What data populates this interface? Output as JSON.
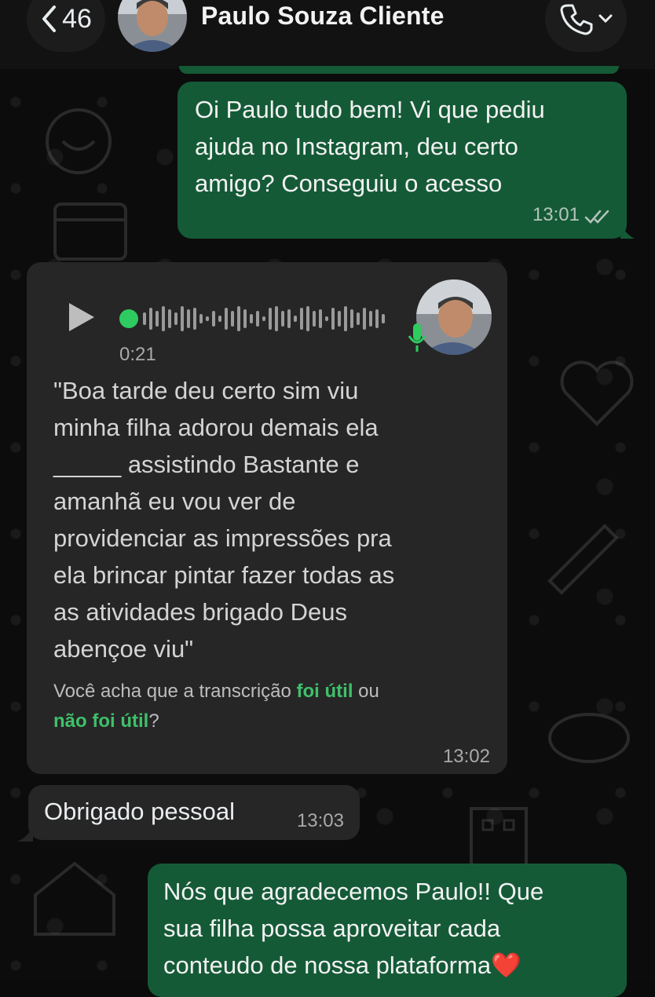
{
  "header": {
    "back_count": "46",
    "contact_name": "Paulo Souza Cliente",
    "back_icon": "chevron-left-icon",
    "call_icon": "phone-icon",
    "call_menu_icon": "chevron-down-icon"
  },
  "messages": [
    {
      "direction": "outgoing",
      "text": "Oi Paulo tudo bem! Vi que pediu\najuda no Instagram, deu certo\namigo? Conseguiu o acesso",
      "time": "13:01",
      "status_icon": "double-check-icon"
    },
    {
      "direction": "incoming",
      "type": "voice",
      "duration": "0:21",
      "play_icon": "play-icon",
      "mic_icon": "microphone-icon",
      "transcript": "\"Boa tarde deu certo sim viu\nminha filha adorou demais ela\n_____ assistindo Bastante e\namanhã eu vou ver de\nprovidenciar as impressões pra\nela brincar pintar fazer todas as\nas atividades brigado Deus\nabençoe viu\"",
      "feedback_prefix": "Você acha que a transcrição ",
      "feedback_useful": "foi útil",
      "feedback_or": " ou",
      "feedback_not_useful": "não foi útil",
      "feedback_suffix": "?",
      "time": "13:02"
    },
    {
      "direction": "incoming",
      "text": "Obrigado pessoal",
      "time": "13:03"
    },
    {
      "direction": "outgoing",
      "text": "Nós que agradecemos Paulo!! Que\nsua filha possa aproveitar cada\nconteudo de nossa plataforma",
      "emoji": "❤️"
    }
  ],
  "colors": {
    "outgoing_bubble": "#155a37",
    "incoming_bubble": "#262626",
    "accent_green": "#3fc06a",
    "header_bg": "#121212"
  }
}
